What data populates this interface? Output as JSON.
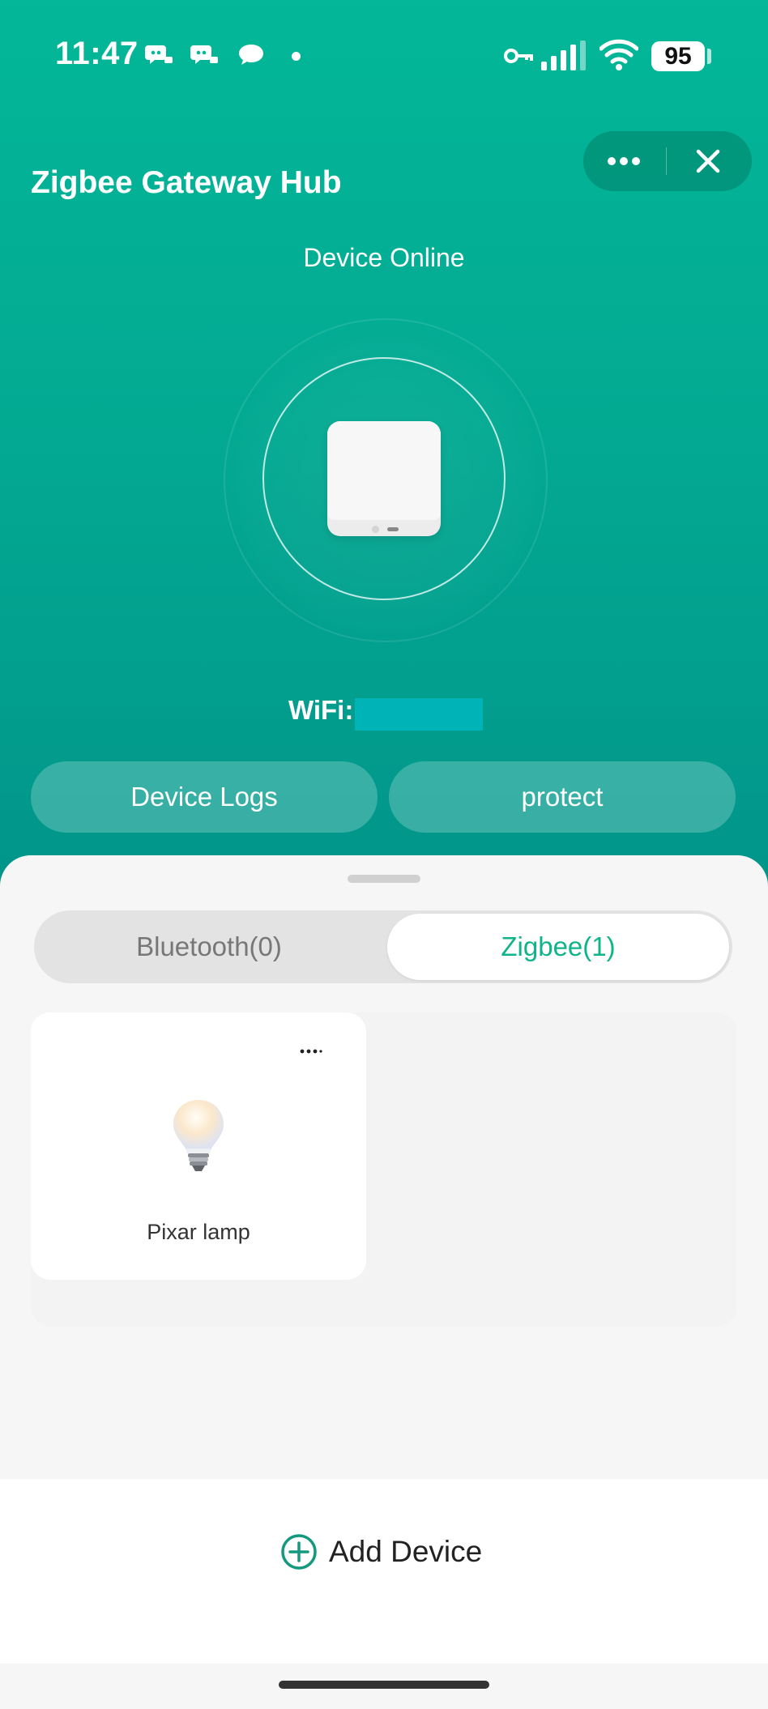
{
  "status_bar": {
    "time": "11:47",
    "battery": "95"
  },
  "header": {
    "title": "Zigbee Gateway Hub",
    "status": "Device Online",
    "wifi_label": "WiFi:"
  },
  "actions": {
    "logs_label": "Device Logs",
    "protect_label": "protect"
  },
  "tabs": {
    "bluetooth_label": "Bluetooth(0)",
    "zigbee_label": "Zigbee(1)",
    "selected": "Zigbee(1)"
  },
  "devices": [
    {
      "name": "Pixar lamp",
      "icon": "light-bulb-icon"
    }
  ],
  "footer": {
    "add_label": "Add Device"
  },
  "colors": {
    "accent": "#03b798",
    "tab_selected_text": "#10b48a",
    "wifi_redaction": "#00b3b6"
  }
}
